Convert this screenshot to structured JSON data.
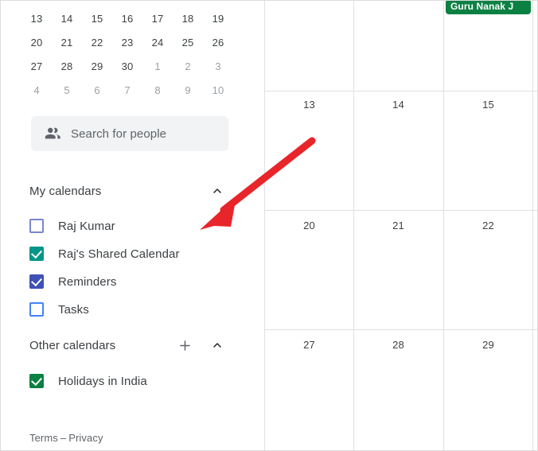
{
  "colors": {
    "accent_green_dark": "#0b8043",
    "accent_teal": "#009688",
    "accent_indigo": "#3f51b5",
    "accent_blue": "#4285f4",
    "accent_periwinkle": "#7986cb",
    "annotation_red": "#e8252a",
    "grid_line": "#e0e0e0",
    "text_primary": "#3c4043",
    "text_muted": "#9aa0a6",
    "search_bg": "#f1f3f4"
  },
  "sidebar": {
    "mini_calendar": {
      "rows": [
        [
          {
            "day": "13",
            "muted": false
          },
          {
            "day": "14",
            "muted": false
          },
          {
            "day": "15",
            "muted": false
          },
          {
            "day": "16",
            "muted": false
          },
          {
            "day": "17",
            "muted": false
          },
          {
            "day": "18",
            "muted": false
          },
          {
            "day": "19",
            "muted": false
          }
        ],
        [
          {
            "day": "20",
            "muted": false
          },
          {
            "day": "21",
            "muted": false
          },
          {
            "day": "22",
            "muted": false
          },
          {
            "day": "23",
            "muted": false
          },
          {
            "day": "24",
            "muted": false
          },
          {
            "day": "25",
            "muted": false
          },
          {
            "day": "26",
            "muted": false
          }
        ],
        [
          {
            "day": "27",
            "muted": false
          },
          {
            "day": "28",
            "muted": false
          },
          {
            "day": "29",
            "muted": false
          },
          {
            "day": "30",
            "muted": false
          },
          {
            "day": "1",
            "muted": true
          },
          {
            "day": "2",
            "muted": true
          },
          {
            "day": "3",
            "muted": true
          }
        ],
        [
          {
            "day": "4",
            "muted": true
          },
          {
            "day": "5",
            "muted": true
          },
          {
            "day": "6",
            "muted": true
          },
          {
            "day": "7",
            "muted": true
          },
          {
            "day": "8",
            "muted": true
          },
          {
            "day": "9",
            "muted": true
          },
          {
            "day": "10",
            "muted": true
          }
        ]
      ]
    },
    "search_people": {
      "placeholder": "Search for people",
      "value": "",
      "icon": "people-icon"
    },
    "my_calendars": {
      "title": "My calendars",
      "collapse_icon": "chevron-up-icon",
      "items": [
        {
          "label": "Raj Kumar",
          "checked": false,
          "color": "#7986cb"
        },
        {
          "label": "Raj's Shared Calendar",
          "checked": true,
          "color": "#009688"
        },
        {
          "label": "Reminders",
          "checked": true,
          "color": "#3f51b5"
        },
        {
          "label": "Tasks",
          "checked": false,
          "color": "#4285f4"
        }
      ]
    },
    "other_calendars": {
      "title": "Other calendars",
      "add_icon": "plus-icon",
      "collapse_icon": "chevron-up-icon",
      "items": [
        {
          "label": "Holidays in India",
          "checked": true,
          "color": "#0b8043"
        }
      ]
    },
    "footer": {
      "terms_label": "Terms",
      "separator": "–",
      "privacy_label": "Privacy"
    }
  },
  "main": {
    "grid": {
      "day_numbers": [
        {
          "day": "13",
          "col": 0,
          "row": 0
        },
        {
          "day": "14",
          "col": 1,
          "row": 0
        },
        {
          "day": "15",
          "col": 2,
          "row": 0
        },
        {
          "day": "20",
          "col": 0,
          "row": 1
        },
        {
          "day": "21",
          "col": 1,
          "row": 1
        },
        {
          "day": "22",
          "col": 2,
          "row": 1
        },
        {
          "day": "27",
          "col": 0,
          "row": 2
        },
        {
          "day": "28",
          "col": 1,
          "row": 2
        },
        {
          "day": "29",
          "col": 2,
          "row": 2
        }
      ],
      "events": [
        {
          "title": "Guru Nanak J",
          "color": "#0b8043",
          "col": 2
        }
      ]
    }
  },
  "annotation": {
    "type": "arrow",
    "color": "#e8252a",
    "points_to": "my-calendars-collapse-area"
  }
}
